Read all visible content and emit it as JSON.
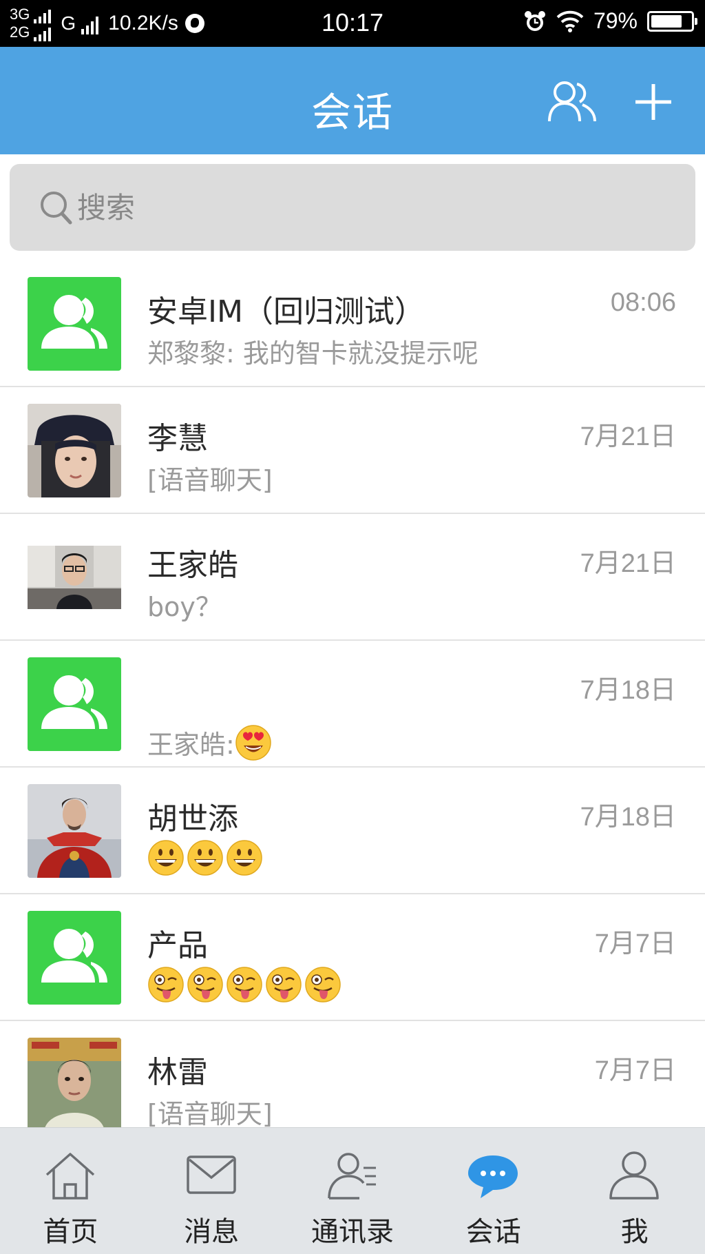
{
  "status_bar": {
    "net1": "3G",
    "net2": "2G",
    "net3": "G",
    "speed": "10.2K/s",
    "time": "10:17",
    "battery": "79%",
    "battery_level": 0.79
  },
  "header": {
    "title": "会话",
    "contacts_icon": "group-contacts-icon",
    "add_icon": "plus-icon",
    "color": "#4fa3e2"
  },
  "search": {
    "placeholder": "搜索"
  },
  "conversations": [
    {
      "name": "安卓IM（回归测试）",
      "time": "08:06",
      "preview": "郑黎黎: 我的智卡就没提示呢",
      "avatar": "group-avatar"
    },
    {
      "name": "李慧",
      "time": "7月21日",
      "preview": "[语音聊天]",
      "avatar": "photo-avatar"
    },
    {
      "name": "王家皓",
      "time": "7月21日",
      "preview": "boy？",
      "avatar": "photo-avatar"
    },
    {
      "name": "",
      "time": "7月18日",
      "preview": "王家皓: ",
      "preview_emoji": "heart-eyes-emoji",
      "avatar": "group-avatar"
    },
    {
      "name": "胡世添",
      "time": "7月18日",
      "preview": "",
      "preview_emoji": "grinning-emoji x3",
      "avatar": "photo-avatar"
    },
    {
      "name": "产品",
      "time": "7月7日",
      "preview": "",
      "preview_emoji": "winking-tongue-emoji x5",
      "avatar": "group-avatar"
    },
    {
      "name": "林雷",
      "time": "7月7日",
      "preview": "[语音聊天]",
      "avatar": "photo-avatar"
    }
  ],
  "bottom_nav": [
    {
      "label": "首页",
      "icon": "home-icon",
      "active": false
    },
    {
      "label": "消息",
      "icon": "envelope-icon",
      "active": false
    },
    {
      "label": "通讯录",
      "icon": "contacts-list-icon",
      "active": false
    },
    {
      "label": "会话",
      "icon": "chat-bubble-icon",
      "active": true
    },
    {
      "label": "我",
      "icon": "person-icon",
      "active": false
    }
  ],
  "colors": {
    "accent": "#4fa3e2",
    "group_avatar": "#3cd24a",
    "secondary_text": "#9a9a9a"
  }
}
